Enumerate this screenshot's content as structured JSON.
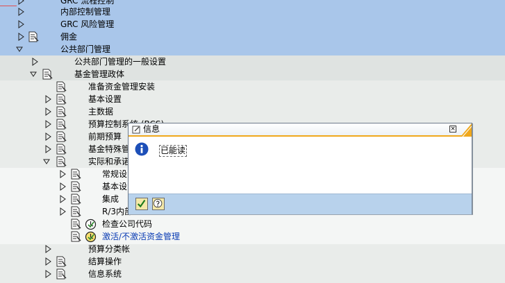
{
  "tree": {
    "items": [
      {
        "label": "GRC 流程控制"
      },
      {
        "label": "内部控制管理"
      },
      {
        "label": "GRC 风险管理"
      },
      {
        "label": "佣金"
      },
      {
        "label": "公共部门管理"
      },
      {
        "label": "公共部门管理的一般设置"
      },
      {
        "label": "基金管理政体"
      },
      {
        "label": "准备资金管理安装"
      },
      {
        "label": "基本设置"
      },
      {
        "label": "主数据"
      },
      {
        "label": "预算控制系统 (BCS)"
      },
      {
        "label": "前期预算"
      },
      {
        "label": "基金特殊管"
      },
      {
        "label": "实际和承诺"
      },
      {
        "label": "常规设"
      },
      {
        "label": "基本设"
      },
      {
        "label": "集成"
      },
      {
        "label": "R/3内部"
      },
      {
        "label": "检查公司代码"
      },
      {
        "label": "激活/不激活资金管理"
      },
      {
        "label": "预算分类帐"
      },
      {
        "label": "结算操作"
      },
      {
        "label": "信息系统"
      }
    ]
  },
  "dialog": {
    "title": "信息",
    "message": "已能读",
    "close_glyph": "×"
  },
  "colors": {
    "selected_band": "#a9c6ea",
    "tree_bg": "#e9ecea",
    "link": "#0a3cb4",
    "dialog_accent": "#f0a81c"
  }
}
